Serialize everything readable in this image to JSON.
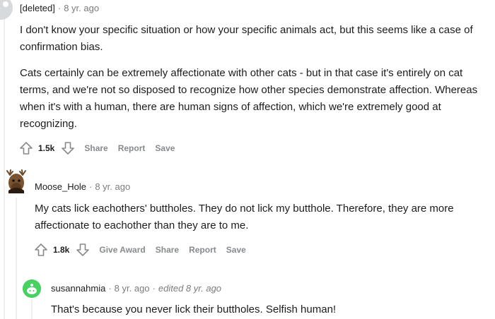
{
  "comments": [
    {
      "author": "[deleted]",
      "time": "8 yr. ago",
      "paragraphs": [
        "I don't know your specific situation or how your specific animals act, but this seems like a case of confirmation bias.",
        "Cats certainly can be extremely affectionate with other cats - but in that case it's entirely on cat terms, and we're not so disposed to recognize how other species demonstrate affection. Whereas when it's with a human, there are human signs of affection, which we're extremely good at recognizing."
      ],
      "votes": "1.5k",
      "actions": [
        "Share",
        "Report",
        "Save"
      ]
    },
    {
      "author": "Moose_Hole",
      "time": "8 yr. ago",
      "paragraphs": [
        "My cats lick eachothers' buttholes. They do not lick my butthole. Therefore, they are more affectionate to eachother than they are to me."
      ],
      "votes": "1.8k",
      "actions": [
        "Give Award",
        "Share",
        "Report",
        "Save"
      ]
    },
    {
      "author": "susannahmia",
      "time": "8 yr. ago",
      "edited": "edited 8 yr. ago",
      "paragraphs": [
        "That's because you never lick their buttholes. Selfish human!"
      ]
    }
  ],
  "separator": "·",
  "icons": {
    "upvote": "upvote-arrow-icon",
    "downvote": "downvote-arrow-icon"
  },
  "colors": {
    "meta_gray": "#878a8c",
    "susan_avatar": "#46d160",
    "thread_line": "#edeff1"
  }
}
